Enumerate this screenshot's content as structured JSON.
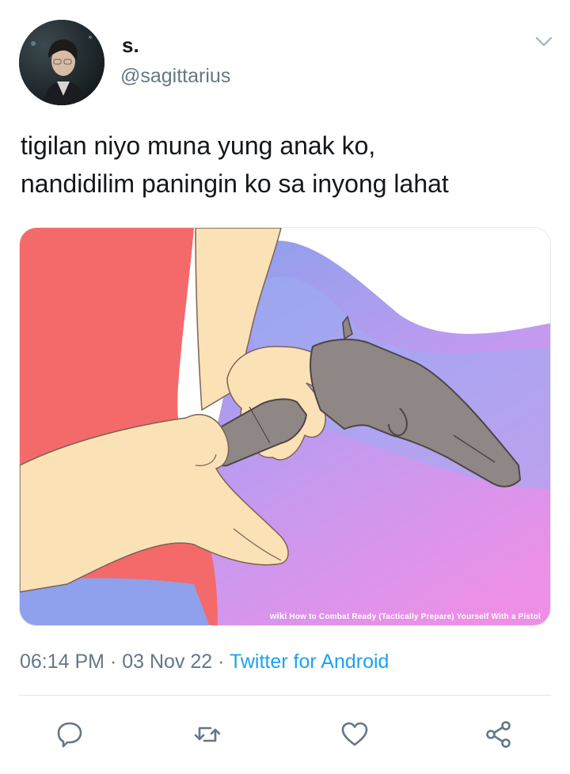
{
  "tweet": {
    "display_name": "s.",
    "handle": "@sagittarius",
    "text_lines": [
      "tigilan niyo muna yung anak ko,",
      "nandidilim paningin ko sa inyong lahat"
    ],
    "media": {
      "watermark_brand": "wiki",
      "watermark_text": "How to Combat Ready (Tactically Prepare) Yourself With a Pistol"
    },
    "time": "06:14 PM",
    "date": "03 Nov 22",
    "source": "Twitter for Android",
    "separator": " · "
  },
  "icons": {
    "menu": "chevron-down-icon",
    "reply": "reply-icon",
    "retweet": "retweet-icon",
    "like": "heart-icon",
    "share": "share-icon"
  },
  "colors": {
    "text_primary": "#14171a",
    "text_secondary": "#657786",
    "link": "#1da1f2",
    "icon": "#657786"
  }
}
